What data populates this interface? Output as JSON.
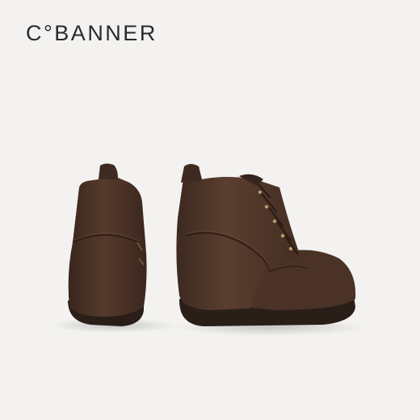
{
  "brand": {
    "logo_text": "C°BANNER"
  },
  "photo": {
    "subject": "pair-of-brown-suede-lace-up-ankle-boots",
    "colors": {
      "background": "#f3f2f0",
      "suede": "#4a3226",
      "suede_shadow": "#2f1f17",
      "sole": "#2a1e18"
    }
  }
}
